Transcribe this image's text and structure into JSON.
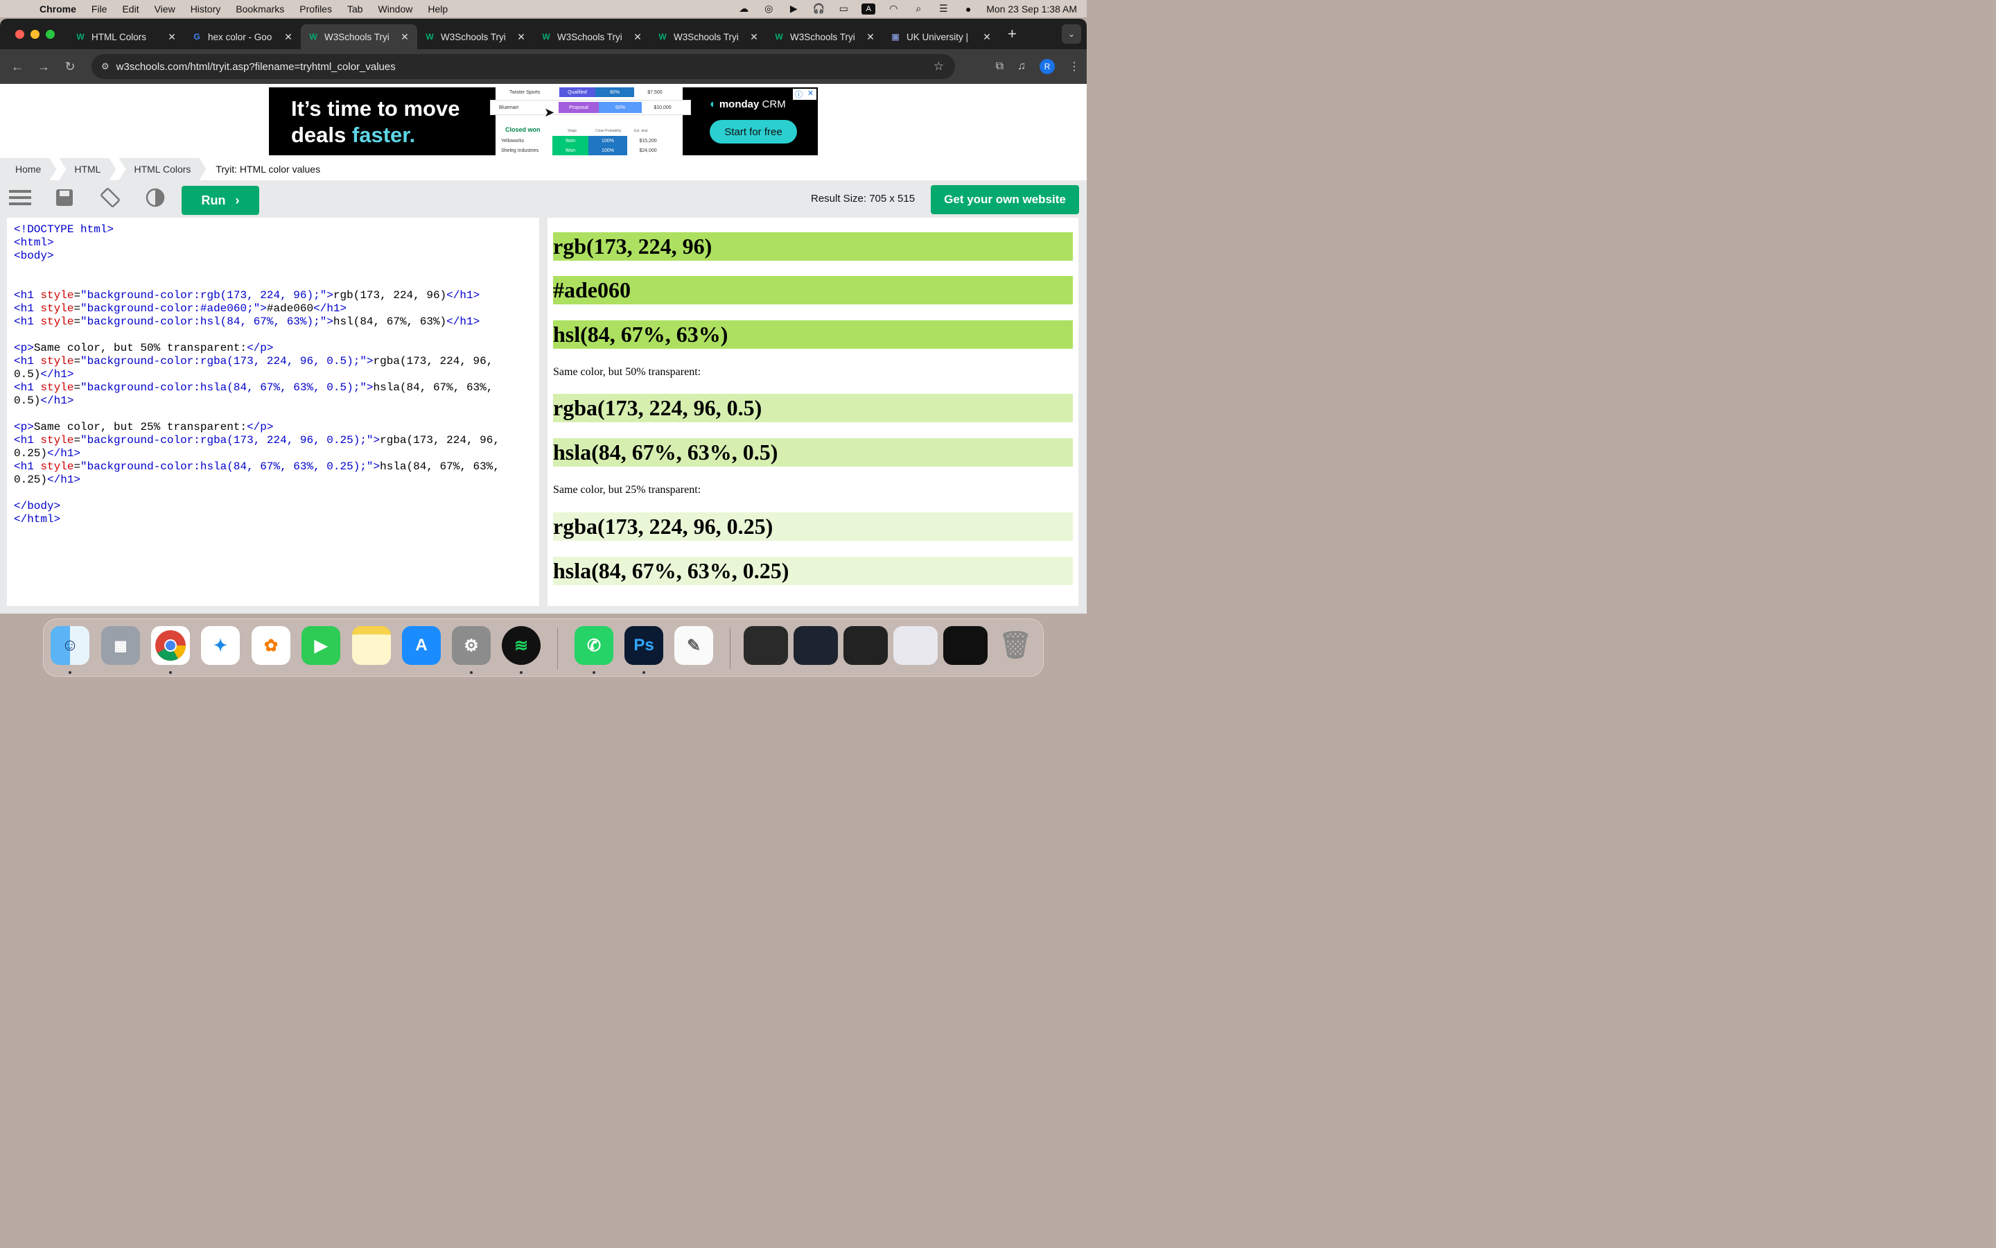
{
  "menubar": {
    "app_name": "Chrome",
    "menus": [
      "File",
      "Edit",
      "View",
      "History",
      "Bookmarks",
      "Profiles",
      "Tab",
      "Window",
      "Help"
    ],
    "clock": "Mon 23 Sep  1:38 AM",
    "status_icons": [
      "creative-cloud-icon",
      "airdrop-icon",
      "play-icon",
      "headphones-icon",
      "battery-icon",
      "keyboard-input-icon",
      "wifi-icon",
      "search-icon",
      "control-center-icon",
      "siri-icon"
    ]
  },
  "tabs": [
    {
      "title": "HTML Colors",
      "favicon": "w3schools-icon",
      "active": false
    },
    {
      "title": "hex color - Goo",
      "favicon": "google-icon",
      "active": false
    },
    {
      "title": "W3Schools Tryi",
      "favicon": "w3schools-icon",
      "active": true
    },
    {
      "title": "W3Schools Tryi",
      "favicon": "w3schools-icon",
      "active": false
    },
    {
      "title": "W3Schools Tryi",
      "favicon": "w3schools-icon",
      "active": false
    },
    {
      "title": "W3Schools Tryi",
      "favicon": "w3schools-icon",
      "active": false
    },
    {
      "title": "W3Schools Tryi",
      "favicon": "w3schools-icon",
      "active": false
    },
    {
      "title": "UK University |",
      "favicon": "bath-spa-icon",
      "active": false
    }
  ],
  "address_bar": {
    "url": "w3schools.com/html/tryit.asp?filename=tryhtml_color_values",
    "profile_initial": "R"
  },
  "ad": {
    "headline_line1": "It’s time to move",
    "headline_line2_plain": "deals ",
    "headline_line2_accent": "faster.",
    "brand_bold": "monday",
    "brand_suffix": " CRM",
    "cta": "Start for free",
    "mock_rows": [
      {
        "name": "Twister Sports",
        "stage": "Qualified",
        "prob": "80%",
        "deal": "$7,500"
      },
      {
        "name": "Bluemart",
        "stage": "Proposal",
        "prob": "60%",
        "deal": "$10,000"
      }
    ],
    "mock_section": "Closed won",
    "mock_headers": [
      "Stage",
      "Close Probability",
      "Est. deal"
    ],
    "mock_won_rows": [
      {
        "name": "Yelloworks",
        "stage": "Won",
        "prob": "100%",
        "deal": "$15,200"
      },
      {
        "name": "Sheleg Industries",
        "stage": "Won",
        "prob": "100%",
        "deal": "$24,000"
      }
    ]
  },
  "breadcrumb": {
    "items": [
      "Home",
      "HTML",
      "HTML Colors"
    ],
    "current": "Tryit: HTML color values"
  },
  "tryit_toolbar": {
    "run_label": "Run",
    "result_size": "Result Size: 705 x 515",
    "own_website": "Get your own website"
  },
  "result": {
    "headings": [
      {
        "text": "rgb(173, 224, 96)",
        "bg": "rgb(173, 224, 96)"
      },
      {
        "text": "#ade060",
        "bg": "#ade060"
      },
      {
        "text": "hsl(84, 67%, 63%)",
        "bg": "hsl(84, 67%, 63%)"
      },
      {
        "text": "rgba(173, 224, 96, 0.5)",
        "bg": "rgba(173, 224, 96, 0.5)"
      },
      {
        "text": "hsla(84, 67%, 63%, 0.5)",
        "bg": "hsla(84, 67%, 63%, 0.5)"
      },
      {
        "text": "rgba(173, 224, 96, 0.25)",
        "bg": "rgba(173, 224, 96, 0.25)"
      },
      {
        "text": "hsla(84, 67%, 63%, 0.25)",
        "bg": "hsla(84, 67%, 63%, 0.25)"
      }
    ],
    "para1": "Same color, but 50% transparent:",
    "para2": "Same color, but 25% transparent:"
  },
  "dock": {
    "apps": [
      "Finder",
      "Launchpad",
      "Chrome",
      "Safari",
      "Photos",
      "FaceTime",
      "Notes",
      "App Store",
      "System Settings",
      "Spotify",
      "WhatsApp",
      "Photoshop",
      "TextEdit"
    ],
    "minimized": [
      "Window 1",
      "Window 2",
      "Window 3",
      "Window 4",
      "Window 5"
    ],
    "trash": "Trash"
  }
}
